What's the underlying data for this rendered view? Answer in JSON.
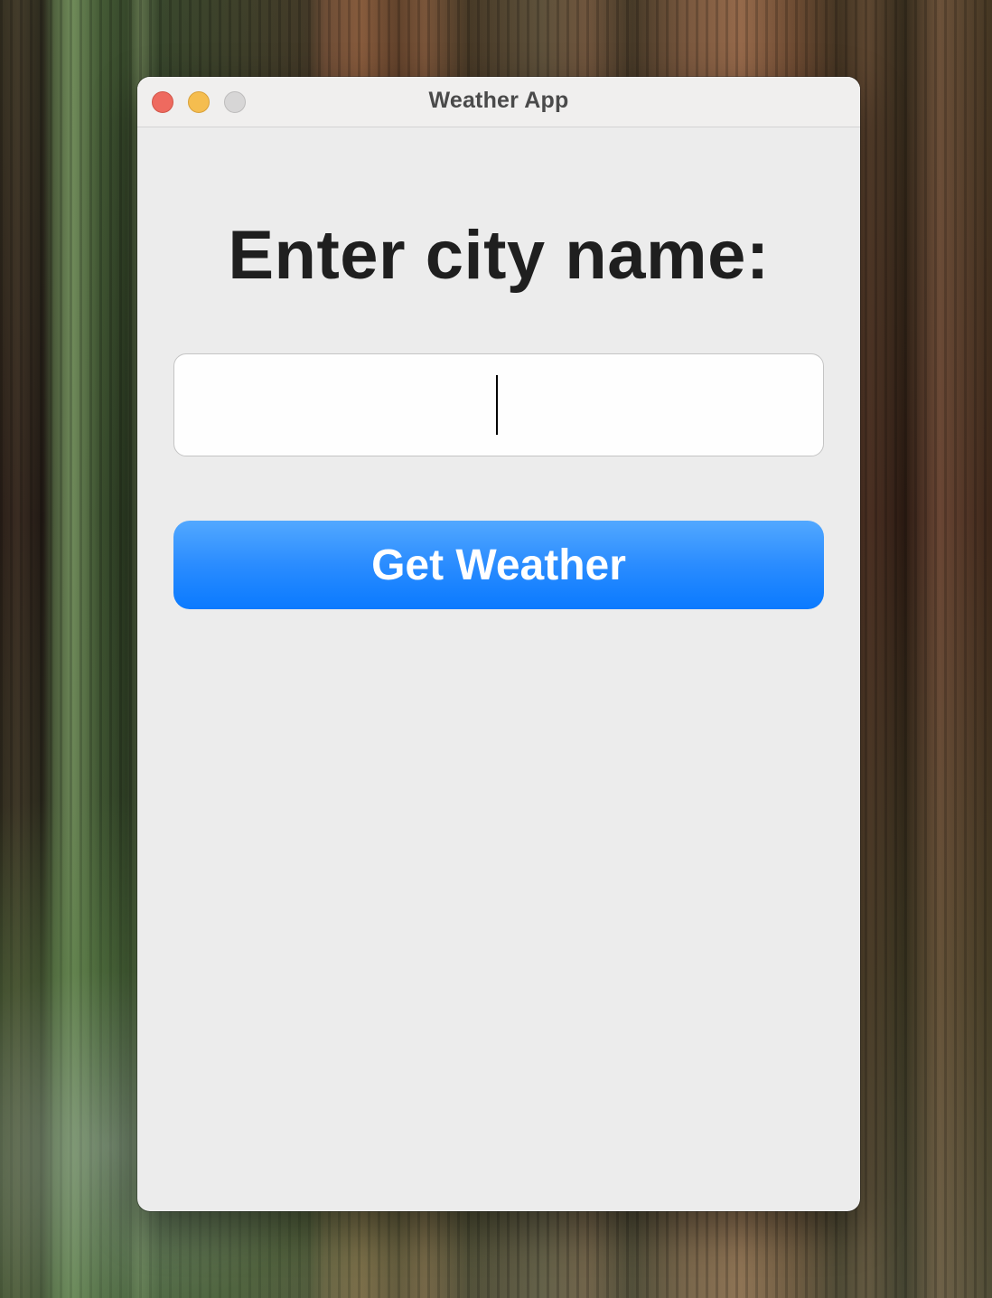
{
  "window": {
    "title": "Weather App"
  },
  "form": {
    "prompt": "Enter city name:",
    "city_value": "",
    "button_label": "Get Weather"
  },
  "icons": {
    "close": "close-icon",
    "minimize": "minimize-icon",
    "zoom": "zoom-icon"
  },
  "colors": {
    "window_background": "#ececec",
    "button_accent": "#0a7aff",
    "traffic_close": "#ee6a5f",
    "traffic_minimize": "#f5bd4f",
    "traffic_zoom_disabled": "#d7d6d6"
  }
}
